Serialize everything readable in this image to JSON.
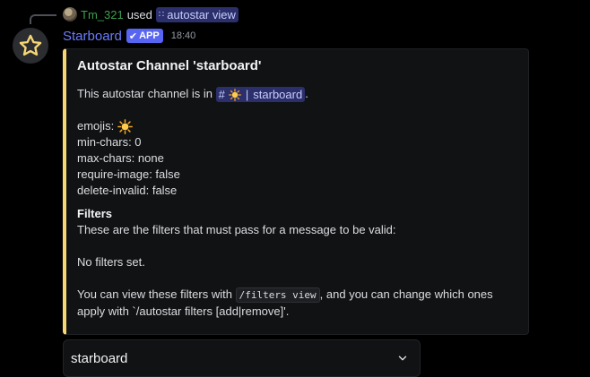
{
  "reply": {
    "username": "Tm_321",
    "used_text": "used",
    "command_icon": "slash-command-icon",
    "command": "autostar view"
  },
  "message": {
    "bot_name": "Starboard",
    "badge": "APP",
    "timestamp": "18:40",
    "avatar_icon": "star-outline-icon"
  },
  "embed": {
    "accent_color": "#f7d774",
    "title": "Autostar Channel 'starboard'",
    "intro_prefix": "This autostar channel is in",
    "channel_mention": {
      "hash": "#",
      "emoji": "sun-emoji",
      "separator": "|",
      "name": "starboard"
    },
    "intro_suffix": ".",
    "settings": {
      "emojis_label": "emojis:",
      "min_chars": "min-chars: 0",
      "max_chars": "max-chars: none",
      "require_image": "require-image: false",
      "delete_invalid": "delete-invalid: false"
    },
    "filters_heading": "Filters",
    "filters_desc": "These are the filters that must pass for a message to be valid:",
    "no_filters": "No filters set.",
    "footer_prefix": "You can view these filters with",
    "footer_code": "/filters view",
    "footer_mid": ", and you can change which ones",
    "footer_line2": "apply with `/autostar filters [add|remove]'."
  },
  "select": {
    "value": "starboard",
    "icon": "chevron-down-icon"
  }
}
